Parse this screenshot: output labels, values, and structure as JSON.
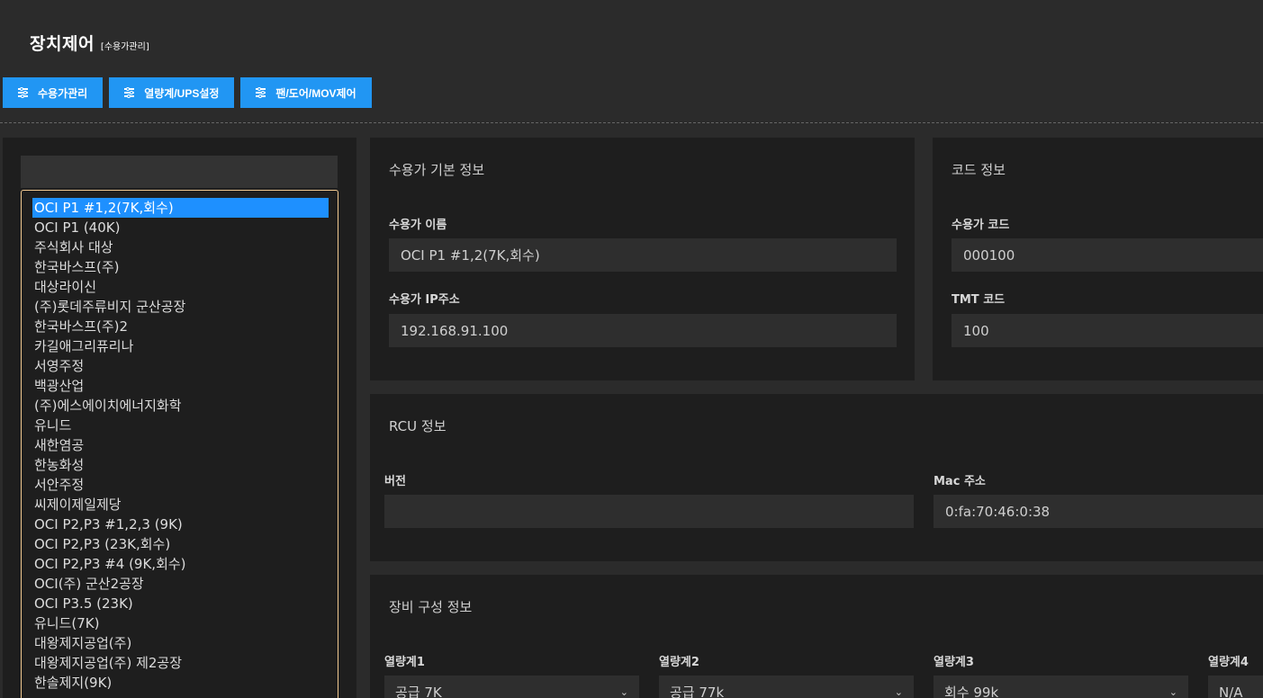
{
  "header": {
    "title": "장치제어",
    "subtitle": "[수용가관리]"
  },
  "toolbar": {
    "buttons": [
      {
        "label": "수용가관리",
        "icon": "sliders-icon"
      },
      {
        "label": "열량계/UPS설정",
        "icon": "sliders-icon"
      },
      {
        "label": "팬/도어/MOV제어",
        "icon": "sliders-icon"
      }
    ],
    "accent_color": "#2196f3"
  },
  "customer_list": {
    "search_value": "",
    "selected_index": 0,
    "items": [
      "OCI P1 #1,2(7K,회수)",
      "OCI P1 (40K)",
      "주식회사 대상",
      "한국바스프(주)",
      "대상라이신",
      "(주)롯데주류비지 군산공장",
      "한국바스프(주)2",
      "카길애그리퓨리나",
      "서영주정",
      "백광산업",
      "(주)에스에이치에너지화학",
      "유니드",
      "새한염공",
      "한농화성",
      "서안주정",
      "씨제이제일제당",
      "OCI P2,P3 #1,2,3 (9K)",
      "OCI P2,P3 (23K,회수)",
      "OCI P2,P3 #4 (9K,회수)",
      "OCI(주) 군산2공장",
      "OCI P3.5 (23K)",
      "유니드(7K)",
      "대왕제지공업(주)",
      "대왕제지공업(주) 제2공장",
      "한솔제지(9K)"
    ]
  },
  "basic_info": {
    "title": "수용가 기본 정보",
    "name_label": "수용가 이름",
    "name_value": "OCI P1 #1,2(7K,회수)",
    "ip_label": "수용가 IP주소",
    "ip_value": "192.168.91.100"
  },
  "code_info": {
    "title": "코드 정보",
    "code_label": "수용가 코드",
    "code_value": "000100",
    "tmt_label": "TMT 코드",
    "tmt_value": "100"
  },
  "rcu_info": {
    "title": "RCU 정보",
    "version_label": "버전",
    "version_value": "",
    "mac_label": "Mac 주소",
    "mac_value": "0:fa:70:46:0:38"
  },
  "equipment_info": {
    "title": "장비 구성 정보",
    "meters": [
      {
        "label": "열량계1",
        "value": "공급 7K"
      },
      {
        "label": "열량계2",
        "value": "공급 77k"
      },
      {
        "label": "열량계3",
        "value": "회수 99k"
      },
      {
        "label": "열량계4",
        "value": "N/A"
      }
    ]
  }
}
